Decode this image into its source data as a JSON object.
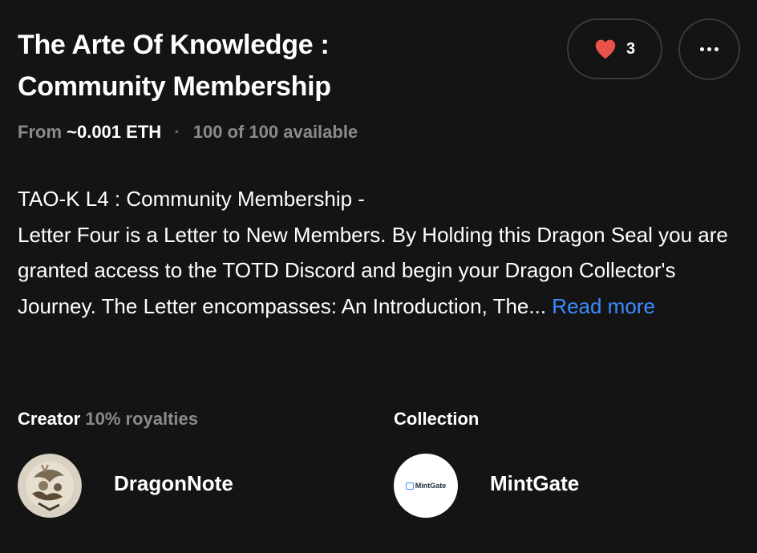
{
  "header": {
    "title_line1": "The Arte Of Knowledge :",
    "title_line2": "Community Membership",
    "like_count": "3",
    "like_icon": "heart-icon",
    "more_icon": "ellipsis-icon",
    "heart_color": "#e8534a"
  },
  "meta": {
    "from_label": "From",
    "price": "~0.001 ETH",
    "separator": "·",
    "availability": "100 of 100 available"
  },
  "description": {
    "line1": "TAO-K L4 : Community Membership -",
    "body": "Letter Four is a Letter to New Members. By Holding this Dragon Seal you are granted access to the TOTD Discord and begin your Dragon Collector's Journey. The Letter encompasses: An Introduction, The...",
    "read_more": "Read more",
    "link_color": "#3d8bff"
  },
  "creator": {
    "label": "Creator",
    "royalties": "10% royalties",
    "name": "DragonNote"
  },
  "collection": {
    "label": "Collection",
    "name": "MintGate",
    "logo_text": "MintGate"
  }
}
